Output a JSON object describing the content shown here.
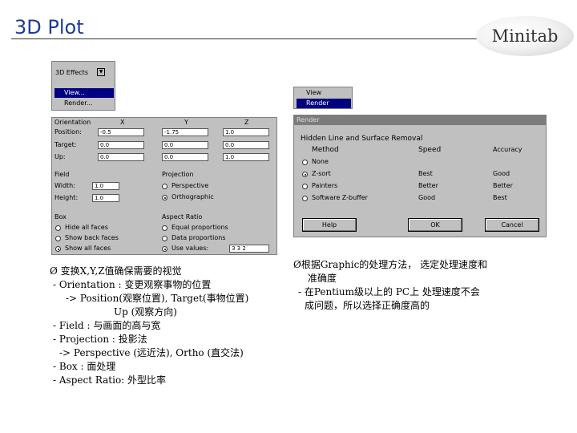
{
  "slide": {
    "title": "3D Plot",
    "logo_text": "Minitab"
  },
  "effects_menu": {
    "button_label": "3D Effects",
    "items": [
      {
        "label": "View..."
      },
      {
        "label": "Render..."
      }
    ]
  },
  "view_render_menu": {
    "items": [
      {
        "label": "View"
      },
      {
        "label": "Render"
      }
    ]
  },
  "view_dialog": {
    "orientation": {
      "heading": "Orientation",
      "col_x": "X",
      "col_y": "Y",
      "col_z": "Z",
      "rows": [
        {
          "label": "Position:",
          "x": "-0.5",
          "y": "-1.75",
          "z": "1.0"
        },
        {
          "label": "Target:",
          "x": "0.0",
          "y": "0.0",
          "z": "0.0"
        },
        {
          "label": "Up:",
          "x": "0.0",
          "y": "0.0",
          "z": "1.0"
        }
      ]
    },
    "field": {
      "heading": "Field",
      "width_label": "Width:",
      "width_value": "1.0",
      "height_label": "Height:",
      "height_value": "1.0"
    },
    "projection": {
      "heading": "Projection",
      "options": [
        "Perspective",
        "Orthographic"
      ],
      "selected": "Orthographic"
    },
    "box": {
      "heading": "Box",
      "options": [
        "Hide all faces",
        "Show back faces",
        "Show all faces"
      ],
      "selected": "Show all faces"
    },
    "aspect": {
      "heading": "Aspect Ratio",
      "options": [
        "Equal proportions",
        "Data proportions",
        "Use values:"
      ],
      "selected": "Use values:",
      "values": "3 3 2"
    }
  },
  "render_dialog": {
    "title": "Render",
    "group": "Hidden Line and Surface Removal",
    "headers": {
      "method": "Method",
      "speed": "Speed",
      "accuracy": "Accuracy"
    },
    "rows": [
      {
        "method": "None",
        "speed": "",
        "accuracy": ""
      },
      {
        "method": "Z-sort",
        "speed": "Best",
        "accuracy": "Good"
      },
      {
        "method": "Painters",
        "speed": "Better",
        "accuracy": "Better"
      },
      {
        "method": "Software Z-buffer",
        "speed": "Good",
        "accuracy": "Best"
      }
    ],
    "selected": "Z-sort",
    "buttons": {
      "help": "Help",
      "ok": "OK",
      "cancel": "Cancel"
    }
  },
  "left_notes": [
    "Ø 变换X,Y,Z值确保需要的视觉",
    "- Orientation : 变更观察事物的位置",
    "-> Position(观察位置), Target(事物位置)",
    "Up (观察方向)",
    "- Field : 与画面的高与宽",
    "- Projection : 投影法",
    "-> Perspective (远近法), Ortho (直交法)",
    "- Box : 面处理",
    "- Aspect Ratio: 外型比率"
  ],
  "right_notes": [
    "Ø根据Graphic的处理方法， 选定处理速度和",
    "准确度",
    "- 在Pentium级以上的 PC上 处理速度不会",
    "成问题，所以选择正确度高的"
  ]
}
